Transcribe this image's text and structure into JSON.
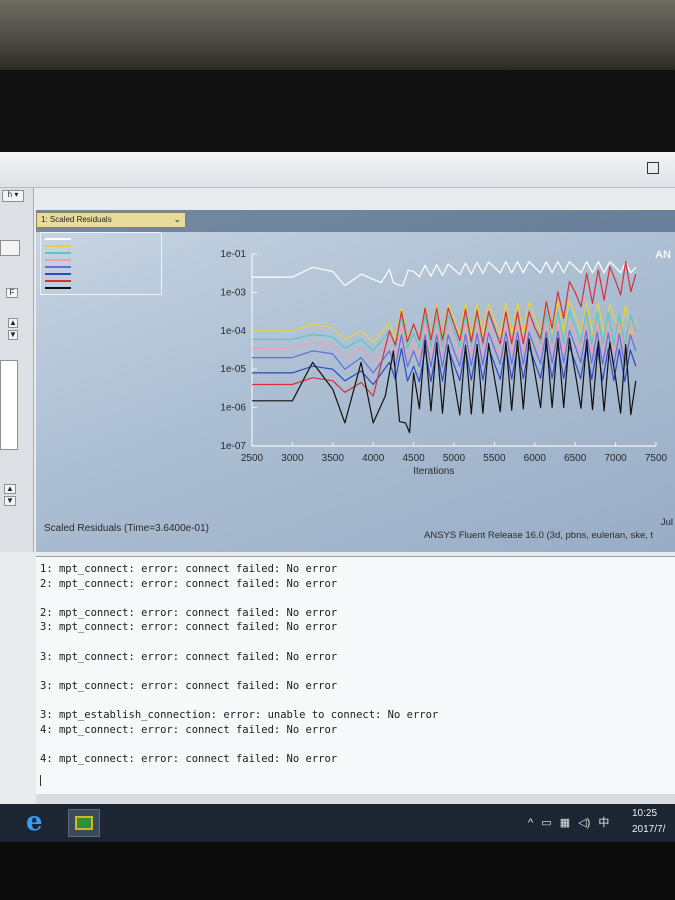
{
  "window": {
    "restore_glyph": "□"
  },
  "left_panel": {
    "top_button": "h ▾",
    "small_button": "F"
  },
  "graphics": {
    "tab_label": "1: Scaled Residuals",
    "brand": "AN"
  },
  "chart_data": {
    "type": "line",
    "xlabel": "Iterations",
    "x_ticks": [
      2500,
      3000,
      3500,
      4000,
      4500,
      5000,
      5500,
      6000,
      6500,
      7000,
      7500
    ],
    "y_ticks": [
      "1e-07",
      "1e-06",
      "1e-05",
      "1e-04",
      "1e-03",
      "1e-01"
    ],
    "y_scale": "log",
    "xlim": [
      2500,
      7500
    ],
    "series": [
      {
        "color": "#ffffff",
        "points": [
          [
            2500,
            0.0025
          ],
          [
            3000,
            0.0025
          ],
          [
            3250,
            0.0045
          ],
          [
            3500,
            0.0035
          ],
          [
            3650,
            0.0015
          ],
          [
            3850,
            0.003
          ],
          [
            4000,
            0.0022
          ],
          [
            4100,
            0.0018
          ],
          [
            4200,
            0.004
          ],
          [
            4300,
            0.0016
          ],
          [
            4500,
            0.0035
          ],
          [
            5000,
            0.004
          ],
          [
            5500,
            0.0045
          ],
          [
            6000,
            0.0045
          ],
          [
            6500,
            0.0045
          ],
          [
            7000,
            0.0045
          ],
          [
            7250,
            0.0045
          ]
        ]
      },
      {
        "color": "#e8d23a",
        "points": [
          [
            2500,
            0.0001
          ],
          [
            3000,
            0.0001
          ],
          [
            3250,
            0.00015
          ],
          [
            3500,
            0.00012
          ],
          [
            3650,
            6e-05
          ],
          [
            3850,
            0.0001
          ],
          [
            4000,
            5e-05
          ],
          [
            4200,
            0.00016
          ],
          [
            4500,
            0.00015
          ],
          [
            5000,
            0.0002
          ],
          [
            5500,
            0.0002
          ],
          [
            6000,
            0.00022
          ],
          [
            6500,
            0.00024
          ],
          [
            7000,
            0.00018
          ],
          [
            7250,
            0.00018
          ]
        ]
      },
      {
        "color": "#58c8c0",
        "points": [
          [
            2500,
            6e-05
          ],
          [
            3000,
            6e-05
          ],
          [
            3250,
            8e-05
          ],
          [
            3500,
            7e-05
          ],
          [
            3650,
            3.5e-05
          ],
          [
            3850,
            6e-05
          ],
          [
            4000,
            3e-05
          ],
          [
            4200,
            0.0001
          ],
          [
            4500,
            9e-05
          ],
          [
            5000,
            0.0001
          ],
          [
            5500,
            0.00011
          ],
          [
            6000,
            0.00012
          ],
          [
            6500,
            0.00013
          ],
          [
            7250,
            0.0001
          ]
        ]
      },
      {
        "color": "#f0a0b0",
        "points": [
          [
            2500,
            3.5e-05
          ],
          [
            3000,
            3.5e-05
          ],
          [
            3250,
            5e-05
          ],
          [
            3500,
            4e-05
          ],
          [
            3650,
            2e-05
          ],
          [
            3850,
            3.5e-05
          ],
          [
            4000,
            1.5e-05
          ],
          [
            4200,
            6e-05
          ],
          [
            4500,
            5e-05
          ],
          [
            5000,
            6e-05
          ],
          [
            5500,
            6e-05
          ],
          [
            6000,
            7e-05
          ],
          [
            6500,
            7e-05
          ],
          [
            7250,
            6e-05
          ]
        ]
      },
      {
        "color": "#6a6ad8",
        "points": [
          [
            2500,
            2e-05
          ],
          [
            3000,
            2e-05
          ],
          [
            3250,
            3e-05
          ],
          [
            3500,
            2.5e-05
          ],
          [
            3650,
            1e-05
          ],
          [
            3850,
            2e-05
          ],
          [
            4000,
            8e-06
          ],
          [
            4200,
            3e-05
          ],
          [
            4500,
            3e-05
          ],
          [
            5000,
            3e-05
          ],
          [
            5500,
            3.5e-05
          ],
          [
            6000,
            3.5e-05
          ],
          [
            6500,
            4e-05
          ],
          [
            7250,
            3e-05
          ]
        ]
      },
      {
        "color": "#3048c0",
        "points": [
          [
            2500,
            8e-06
          ],
          [
            3000,
            8e-06
          ],
          [
            3250,
            1.2e-05
          ],
          [
            3500,
            1e-05
          ],
          [
            3650,
            5e-06
          ],
          [
            3850,
            9e-06
          ],
          [
            4000,
            4e-06
          ],
          [
            4200,
            1.5e-05
          ],
          [
            4500,
            1.2e-05
          ],
          [
            5000,
            1.3e-05
          ],
          [
            5500,
            1.4e-05
          ],
          [
            6000,
            1.5e-05
          ],
          [
            6500,
            1.5e-05
          ],
          [
            7250,
            1.2e-05
          ]
        ]
      },
      {
        "color": "#d8303a",
        "points": [
          [
            2500,
            4e-06
          ],
          [
            3000,
            4e-06
          ],
          [
            3250,
            6e-06
          ],
          [
            3500,
            5e-06
          ],
          [
            3650,
            2.5e-06
          ],
          [
            3850,
            4.5e-06
          ],
          [
            4000,
            2e-06
          ],
          [
            4200,
            0.0001
          ],
          [
            4500,
            0.00015
          ],
          [
            5000,
            0.00015
          ],
          [
            5500,
            0.00012
          ],
          [
            6000,
            0.00012
          ],
          [
            6500,
            0.001
          ],
          [
            7000,
            0.002
          ],
          [
            7250,
            0.003
          ]
        ]
      },
      {
        "color": "#111111",
        "points": [
          [
            2500,
            1.5e-06
          ],
          [
            3000,
            1.5e-06
          ],
          [
            3250,
            1.5e-05
          ],
          [
            3500,
            3e-06
          ],
          [
            3650,
            4e-07
          ],
          [
            3850,
            1.5e-05
          ],
          [
            4000,
            4e-07
          ],
          [
            4150,
            2e-06
          ],
          [
            4250,
            3e-05
          ],
          [
            4400,
            4e-07
          ],
          [
            4500,
            8e-06
          ],
          [
            5000,
            5e-06
          ],
          [
            5500,
            6e-06
          ],
          [
            6000,
            8e-06
          ],
          [
            6500,
            8e-06
          ],
          [
            7000,
            6e-06
          ],
          [
            7250,
            5e-06
          ]
        ]
      }
    ]
  },
  "caption": "Scaled Residuals  (Time=3.6400e-01)",
  "release": "ANSYS Fluent Release 16.0 (3d, pbns, eulerian, ske, t",
  "date": "Jul",
  "console": {
    "lines": [
      "1: mpt_connect: error: connect failed: No error",
      "2: mpt_connect: error: connect failed: No error",
      "",
      "2: mpt_connect: error: connect failed: No error",
      "3: mpt_connect: error: connect failed: No error",
      "",
      "3: mpt_connect: error: connect failed: No error",
      "",
      "3: mpt_connect: error: connect failed: No error",
      "",
      "3: mpt_establish_connection: error: unable to connect: No error",
      "4: mpt_connect: error: connect failed: No error",
      "",
      "4: mpt_connect: error: connect failed: No error"
    ]
  },
  "taskbar": {
    "ie_glyph": "e",
    "tray": {
      "chevron": "^",
      "ime": "中",
      "time": "10:25",
      "date": "2017/7/"
    }
  }
}
